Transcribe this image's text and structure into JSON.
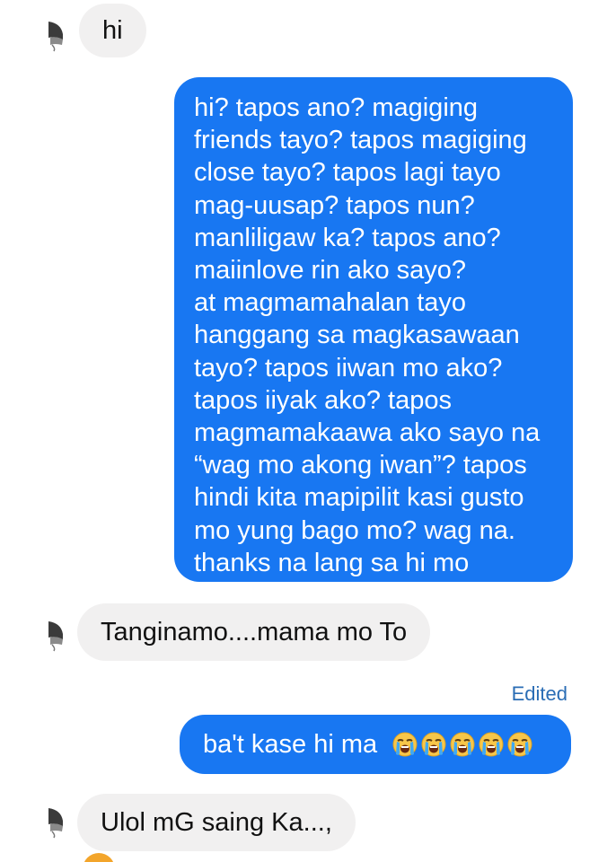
{
  "messages": [
    {
      "sender": "other",
      "text": "hi"
    },
    {
      "sender": "me",
      "lines": [
        "hi? tapos ano? magiging",
        "friends tayo? tapos magiging",
        "close tayo? tapos lagi tayo",
        "mag-uusap? tapos nun?",
        "manliligaw ka? tapos ano?",
        "maiinlove rin ako sayo?",
        "at magmamahalan tayo",
        "hanggang sa magkasawaan",
        "tayo? tapos iiwan mo ako?",
        "tapos iiyak ako? tapos",
        "magmamakaawa ako sayo na",
        "“wag mo akong iwan”? tapos",
        "hindi kita mapipilit kasi gusto",
        "mo yung bago mo? wag na.",
        "thanks na lang sa hi mo"
      ]
    },
    {
      "sender": "other",
      "text": "Tanginamo....mama mo To"
    },
    {
      "sender": "me",
      "text": "ba't kase hi ma",
      "emoji": "loudly-crying-face",
      "emoji_count": 5,
      "status": "Edited"
    },
    {
      "sender": "other",
      "text": "Ulol mG saing Ka...,"
    }
  ],
  "colors": {
    "outgoing_bubble": "#1877f2",
    "incoming_bubble": "#f1f0f0",
    "edited_label": "#2a6db5",
    "emoji_face": "#f7c64a",
    "emoji_tears": "#3fa9f5"
  }
}
